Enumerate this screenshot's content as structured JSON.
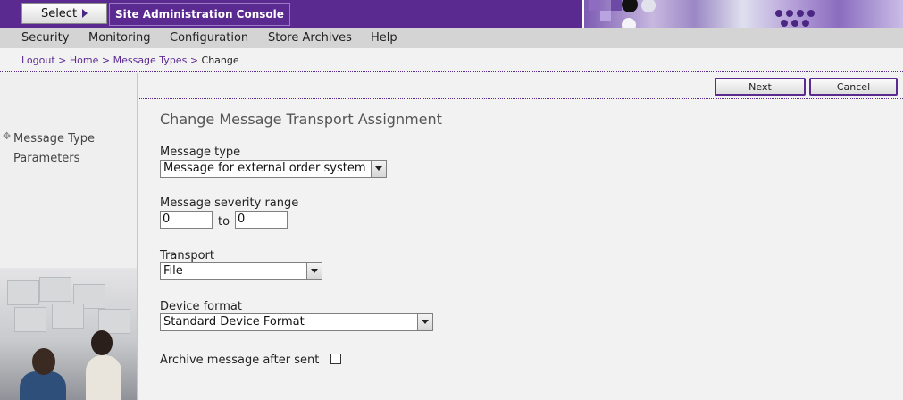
{
  "banner": {
    "select_label": "Select",
    "console_title": "Site Administration Console"
  },
  "menu": [
    {
      "label": "Security"
    },
    {
      "label": "Monitoring"
    },
    {
      "label": "Configuration"
    },
    {
      "label": "Store Archives"
    },
    {
      "label": "Help"
    }
  ],
  "breadcrumb": {
    "items": [
      "Logout",
      "Home",
      "Message Types"
    ],
    "separator": ">",
    "current": "Change"
  },
  "sidebar": {
    "items": [
      {
        "label": "Message Type"
      },
      {
        "label": "Parameters"
      }
    ]
  },
  "actions": {
    "next_label": "Next",
    "cancel_label": "Cancel"
  },
  "form": {
    "title": "Change Message Transport Assignment",
    "message_type": {
      "label": "Message type",
      "value": "Message for external order system"
    },
    "severity": {
      "label": "Message severity range",
      "from": "0",
      "to_label": "to",
      "to": "0"
    },
    "transport": {
      "label": "Transport",
      "value": "File"
    },
    "device_format": {
      "label": "Device format",
      "value": "Standard Device Format"
    },
    "archive": {
      "label": "Archive message after sent",
      "checked": false
    }
  },
  "colors": {
    "brand": "#5b2a91",
    "menubar": "#d4d4d4",
    "background": "#f2f2f2"
  }
}
